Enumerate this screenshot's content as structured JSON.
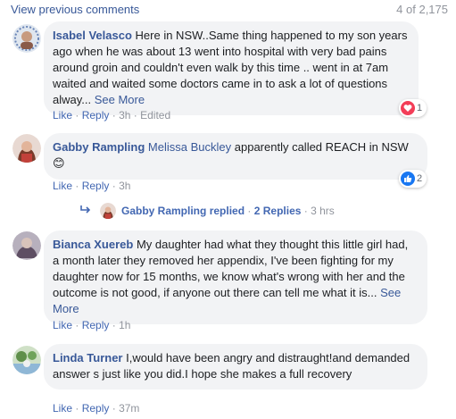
{
  "header": {
    "view_previous": "View previous comments",
    "count": "4 of 2,175"
  },
  "comments": [
    {
      "author": "Isabel Velasco",
      "text": "Here in NSW..Same thing happened to my son years ago when he was about 13 went into hospital with very bad pains around groin and couldn't even walk by this time .. went in at 7am waited and waited some doctors came in to ask a lot of questions alway...",
      "see_more": "See More",
      "like": "Like",
      "sep": "·",
      "reply": "Reply",
      "time": "3h",
      "edited": "Edited",
      "reaction": {
        "icon": "heart-icon",
        "count": "1",
        "color": "#f33e58"
      }
    },
    {
      "author": "Gabby Rampling",
      "tag": "Melissa Buckley",
      "text": "apparently called REACH in NSW",
      "emoji": "😊",
      "like": "Like",
      "sep": "·",
      "reply": "Reply",
      "time": "3h",
      "reaction": {
        "icon": "thumbs-up-icon",
        "count": "2",
        "color": "#1877f2"
      },
      "replies": {
        "author": "Gabby Rampling",
        "replied": "replied",
        "count_label": "2 Replies",
        "time": "3 hrs"
      }
    },
    {
      "author": "Bianca Xuereb",
      "text": "My daughter had what they thought this little girl had, a month later they removed her appendix, I've been fighting for my daughter now for 15 months, we know what's wrong with her and the outcome is not good, if anyone out there can tell me what it is...",
      "see_more": "See More",
      "like": "Like",
      "sep": "·",
      "reply": "Reply",
      "time": "1h"
    },
    {
      "author": "Linda Turner",
      "text": "I,would have been angry and distraught!and demanded answer s just like you did.I hope she makes a full recovery",
      "like": "Like",
      "sep": "·",
      "reply": "Reply",
      "time": "37m"
    }
  ],
  "colors": {
    "link": "#385898",
    "action": "#4267b2",
    "muted": "#90949c",
    "bubble": "#f2f3f5"
  }
}
